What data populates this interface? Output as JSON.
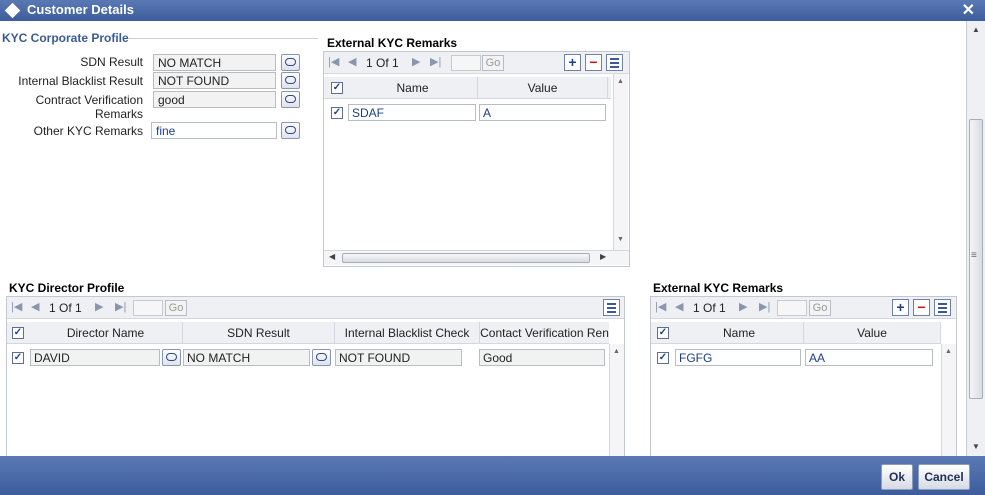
{
  "window": {
    "title": "Customer Details"
  },
  "kyc_corporate": {
    "title": "KYC Corporate Profile",
    "fields": {
      "sdn_label": "SDN Result",
      "sdn_value": "NO MATCH",
      "blacklist_label": "Internal Blacklist Result",
      "blacklist_value": "NOT FOUND",
      "contract_label_1": "Contract Verification",
      "contract_label_2": "Remarks",
      "contract_value": "good",
      "other_label": "Other KYC Remarks",
      "other_value": "fine"
    }
  },
  "ext_kyc_top": {
    "title": "External KYC Remarks",
    "page": "1 Of 1",
    "go": "Go",
    "columns": [
      "Name",
      "Value"
    ],
    "rows": [
      {
        "name": "SDAF",
        "value": "A",
        "checked": "✓"
      }
    ]
  },
  "director": {
    "title": "KYC Director Profile",
    "page": "1 Of 1",
    "go": "Go",
    "columns": [
      "Director Name",
      "SDN Result",
      "Internal Blacklist Check",
      "Contact Verification Ren"
    ],
    "rows": [
      {
        "name": "DAVID",
        "sdn": "NO MATCH",
        "blacklist": "NOT FOUND",
        "contact": "Good",
        "checked": "✓"
      }
    ]
  },
  "ext_kyc_bottom": {
    "title": "External KYC Remarks",
    "page": "1 Of 1",
    "go": "Go",
    "columns": [
      "Name",
      "Value"
    ],
    "rows": [
      {
        "name": "FGFG",
        "value": "AA",
        "checked": "✓"
      }
    ]
  },
  "footer": {
    "ok": "Ok",
    "cancel": "Cancel"
  },
  "colors": {
    "title_bar": "#3c5c9c",
    "section_accent": "#3b5a95"
  }
}
